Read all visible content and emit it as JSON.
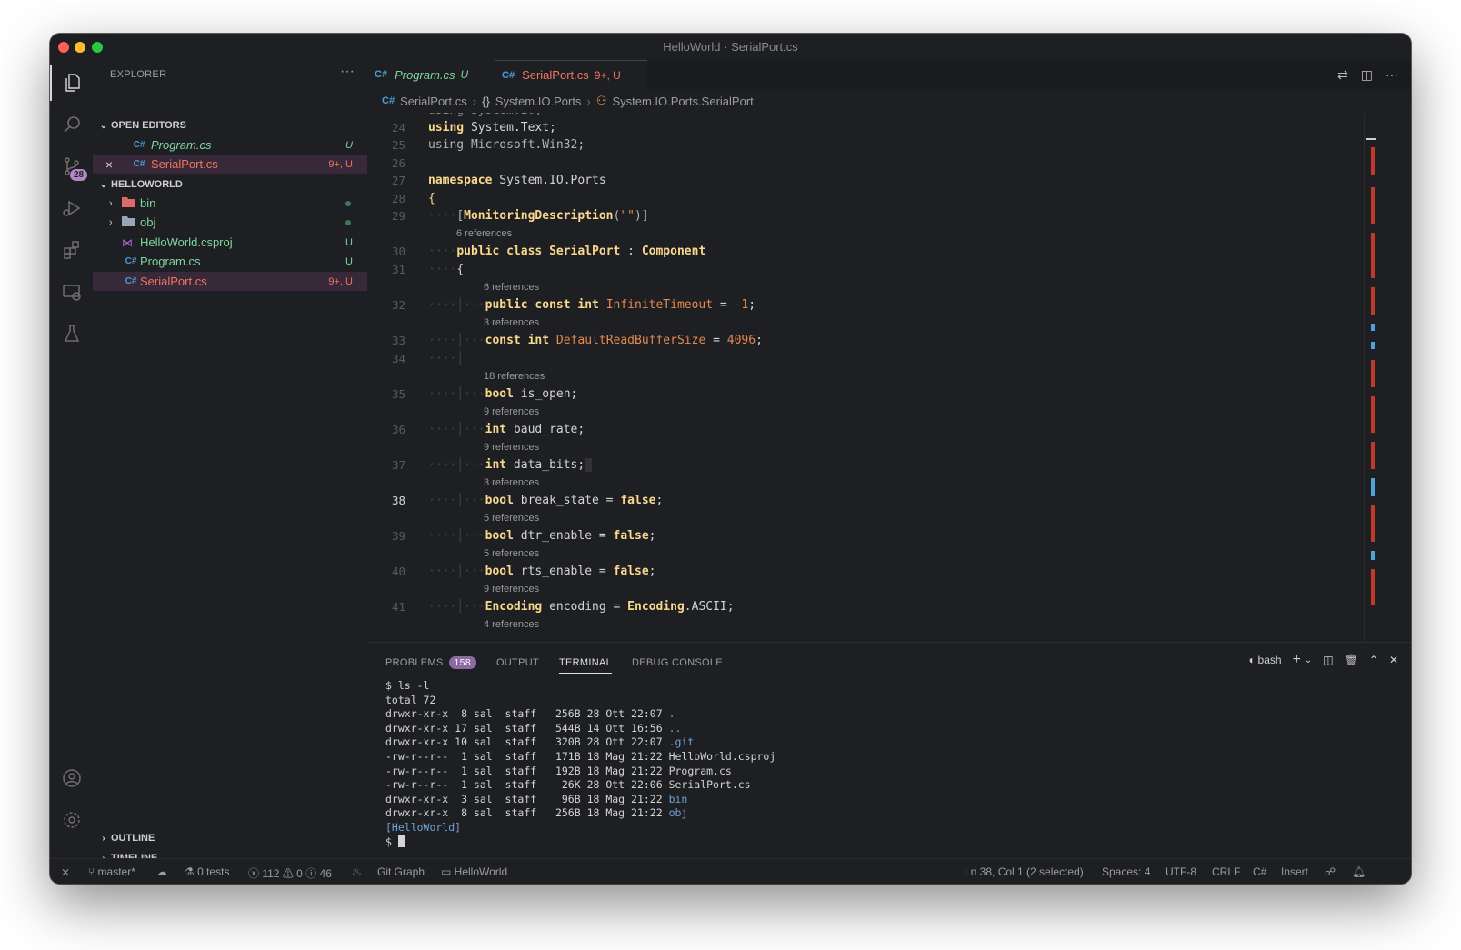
{
  "window": {
    "title": "HelloWorld · SerialPort.cs"
  },
  "activity_bar": {
    "scm_badge": "28"
  },
  "sidebar": {
    "header": "EXPLORER",
    "open_editors_label": "OPEN EDITORS",
    "open_editors": [
      {
        "icon": "C#",
        "name": "Program.cs",
        "status": "U"
      },
      {
        "icon": "C#",
        "name": "SerialPort.cs",
        "status": "9+, U"
      }
    ],
    "project_label": "HELLOWORLD",
    "files": [
      {
        "name": "bin"
      },
      {
        "name": "obj"
      },
      {
        "name": "HelloWorld.csproj",
        "status": "U"
      },
      {
        "icon": "C#",
        "name": "Program.cs",
        "status": "U"
      },
      {
        "icon": "C#",
        "name": "SerialPort.cs",
        "status": "9+, U"
      }
    ],
    "outline_label": "OUTLINE",
    "timeline_label": "TIMELINE"
  },
  "tabs": [
    {
      "icon": "C#",
      "label": "Program.cs",
      "status": "U"
    },
    {
      "icon": "C#",
      "label": "SerialPort.cs",
      "status": "9+, U"
    }
  ],
  "breadcrumb": [
    "SerialPort.cs",
    "System.IO.Ports",
    "System.IO.Ports.SerialPort"
  ],
  "editor": {
    "lines": {
      "24": "24",
      "25": "25",
      "26": "26",
      "27": "27",
      "28": "28",
      "29": "29",
      "30": "30",
      "31": "31",
      "32": "32",
      "33": "33",
      "34": "34",
      "35": "35",
      "36": "36",
      "37": "37",
      "38": "38",
      "39": "39",
      "40": "40",
      "41": "41"
    },
    "references": {
      "r29": "6 references",
      "r31": "6 references",
      "r32": "3 references",
      "r34": "18 references",
      "r35": "9 references",
      "r36": "9 references",
      "r37": "3 references",
      "r38": "5 references",
      "r39": "5 references",
      "r40": "9 references",
      "r41": "4 references"
    }
  },
  "panel": {
    "tabs": [
      "PROBLEMS",
      "OUTPUT",
      "TERMINAL",
      "DEBUG CONSOLE"
    ],
    "problems_count": "158",
    "shell": "bash",
    "terminal": {
      "cmd": "$ ls -l",
      "total": "total 72",
      "rows": [
        {
          "perm": "drwxr-xr-x",
          "info": "  8 sal  staff   256B 28 Ott 22:07 ",
          "name": "."
        },
        {
          "perm": "drwxr-xr-x",
          "info": " 17 sal  staff   544B 14 Ott 16:56 ",
          "name": ".."
        },
        {
          "perm": "drwxr-xr-x",
          "info": " 10 sal  staff   320B 28 Ott 22:07 ",
          "name": ".git"
        },
        {
          "perm": "-rw-r--r--",
          "info": "  1 sal  staff   171B 18 Mag 21:22 ",
          "name": "HelloWorld.csproj"
        },
        {
          "perm": "-rw-r--r--",
          "info": "  1 sal  staff   192B 18 Mag 21:22 ",
          "name": "Program.cs"
        },
        {
          "perm": "-rw-r--r--",
          "info": "  1 sal  staff    26K 28 Ott 22:06 ",
          "name": "SerialPort.cs"
        },
        {
          "perm": "drwxr-xr-x",
          "info": "  3 sal  staff    96B 18 Mag 21:22 ",
          "name": "bin"
        },
        {
          "perm": "drwxr-xr-x",
          "info": "  8 sal  staff   256B 18 Mag 21:22 ",
          "name": "obj"
        }
      ],
      "prompt_dir": "[HelloWorld]",
      "prompt": "$ "
    }
  },
  "statusbar": {
    "branch": "master*",
    "tests": "0 tests",
    "errors": "112",
    "warnings": "0",
    "infos": "46",
    "git_graph": "Git Graph",
    "folder": "HelloWorld",
    "position": "Ln 38, Col 1 (2 selected)",
    "spaces": "Spaces: 4",
    "encoding": "UTF-8",
    "eol": "CRLF",
    "language": "C#",
    "mode": "Insert"
  },
  "colors": {
    "modified_red": "#f0765e",
    "untracked_green": "#7ed69e",
    "keyword_yellow": "#f9d88c",
    "identifier_orange": "#e4894f",
    "selection_purple": "#37283a"
  }
}
